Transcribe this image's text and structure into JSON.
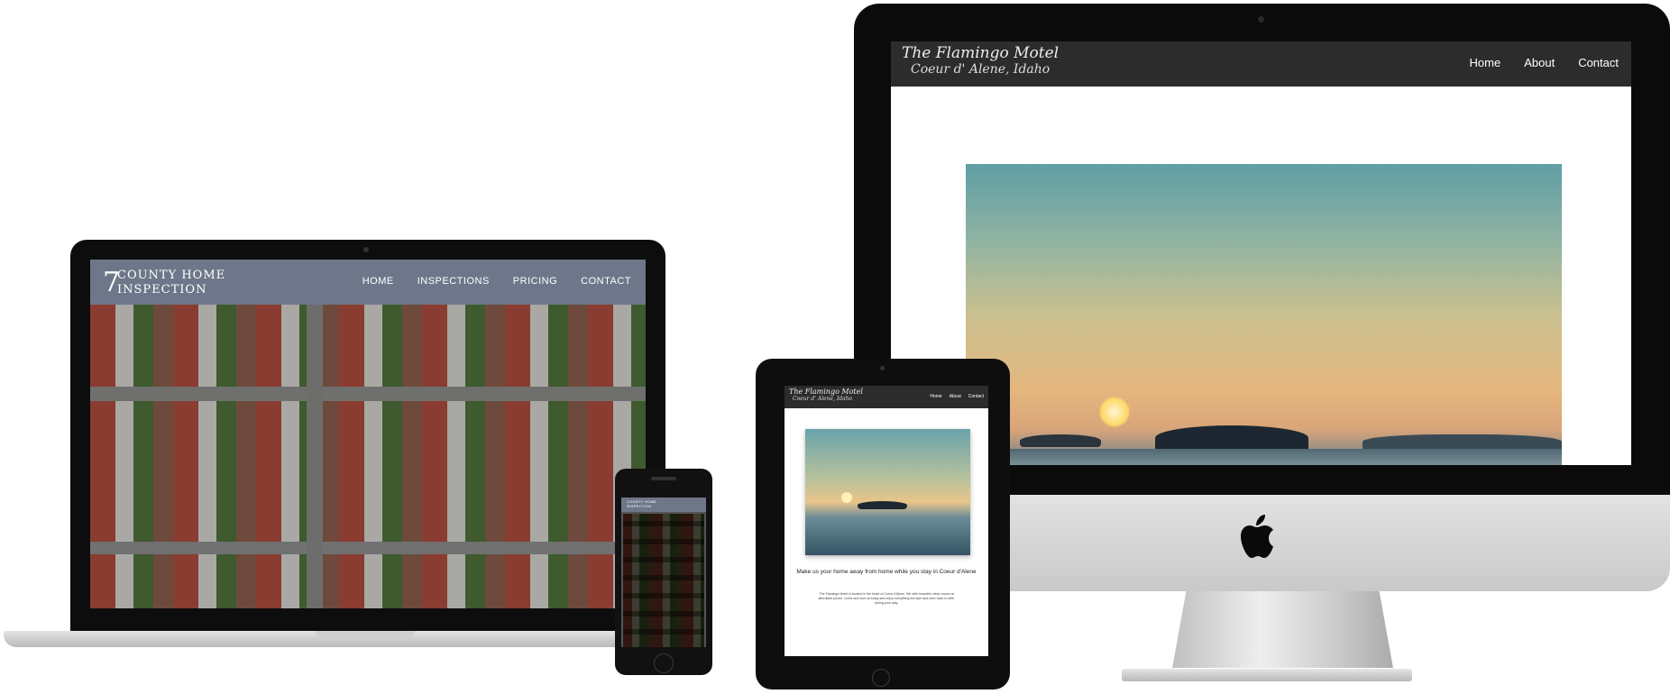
{
  "desktop": {
    "title": "The Flamingo Motel",
    "subtitle": "Coeur d' Alene, Idaho",
    "nav": [
      "Home",
      "About",
      "Contact"
    ],
    "logo_glyph": ""
  },
  "laptop": {
    "logo_mark": "7",
    "title_line1": "County Home",
    "title_line2": "Inspection",
    "nav": [
      "HOME",
      "INSPECTIONS",
      "PRICING",
      "CONTACT"
    ]
  },
  "phone": {
    "title_line1": "County Home",
    "title_line2": "Inspection"
  },
  "tablet": {
    "title": "The Flamingo Motel",
    "subtitle": "Coeur d' Alene, Idaho",
    "nav": [
      "Home",
      "About",
      "Contact"
    ],
    "tagline": "Make us your home away from home while you stay in Coeur d'Alene",
    "body": "The Flamingo Motel is located in the heart of Coeur d'Alene. We offer beautiful clean rooms at affordable prices. Come and visit us today and enjoy everything the lake and town have to offer during your stay."
  }
}
